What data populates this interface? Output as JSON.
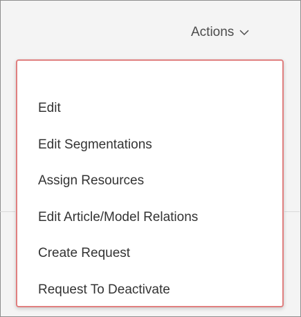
{
  "header": {
    "actions_label": "Actions",
    "actions_icon": "chevron-down-icon"
  },
  "menu": {
    "items": [
      {
        "label": "Edit"
      },
      {
        "label": "Edit Segmentations"
      },
      {
        "label": "Assign Resources"
      },
      {
        "label": "Edit Article/Model Relations"
      },
      {
        "label": "Create Request"
      },
      {
        "label": "Request To Deactivate"
      }
    ]
  },
  "colors": {
    "menu_border": "#e07f7f",
    "text": "#333333",
    "background": "#f4f4f4"
  }
}
